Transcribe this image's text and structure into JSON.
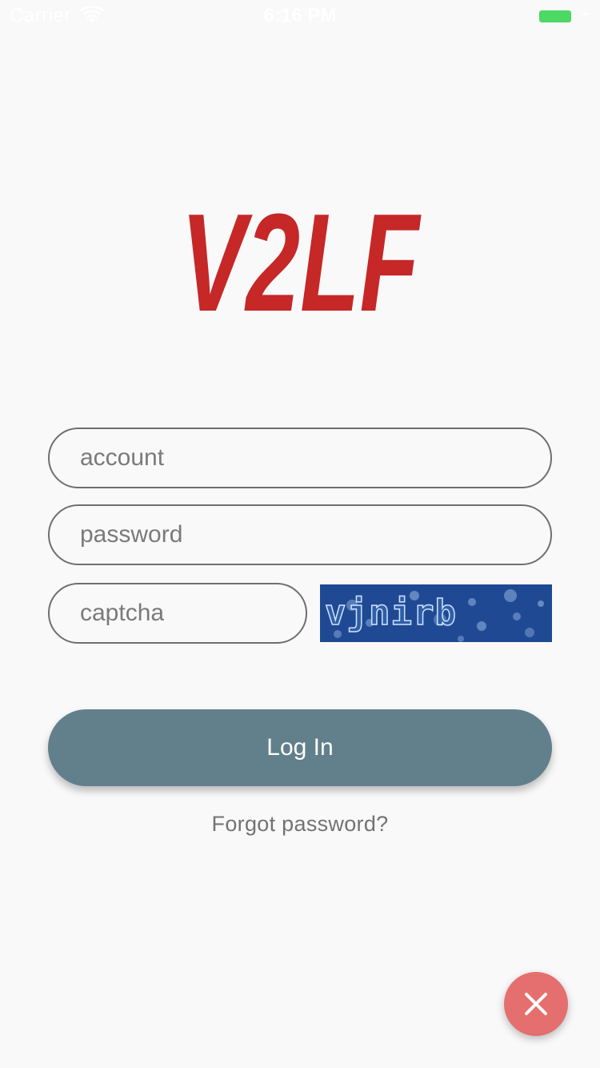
{
  "status_bar": {
    "carrier": "Carrier",
    "time": "6:16 PM",
    "battery_color": "#4cd964"
  },
  "logo": {
    "text": "V2LF",
    "color": "#c62727"
  },
  "form": {
    "account_placeholder": "account",
    "password_placeholder": "password",
    "captcha_placeholder": "captcha",
    "captcha_image_text": "vjnirb"
  },
  "login_button": {
    "label": "Log In",
    "color": "#627f8c"
  },
  "forgot_password": "Forgot password?",
  "close_button": {
    "icon": "close-icon",
    "color": "#e46f6e"
  }
}
